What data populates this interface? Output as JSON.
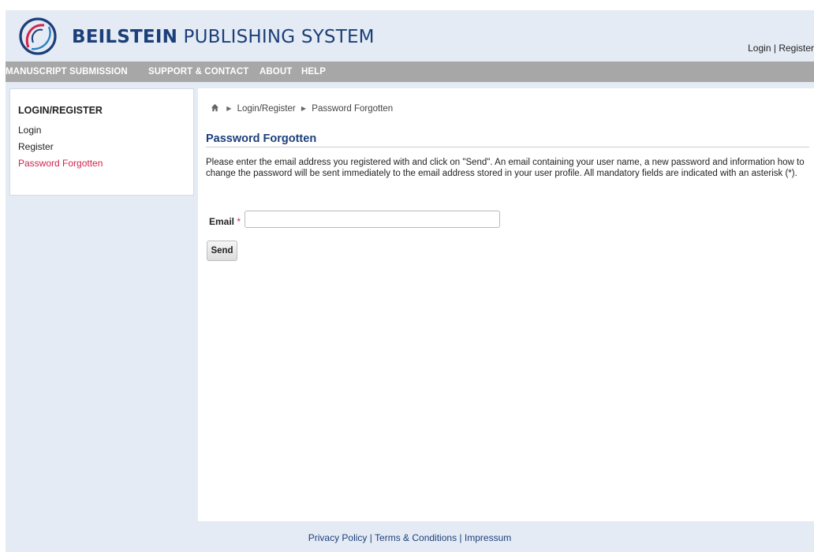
{
  "header": {
    "brand_bold": "BEILSTEIN",
    "brand_light": "PUBLISHING SYSTEM",
    "login_link": "Login",
    "separator": "|",
    "register_link": "Register"
  },
  "nav": {
    "items": [
      "MANUSCRIPT SUBMISSION",
      "SUPPORT & CONTACT",
      "ABOUT",
      "HELP"
    ]
  },
  "sidebar": {
    "title": "LOGIN/REGISTER",
    "items": [
      {
        "label": "Login"
      },
      {
        "label": "Register"
      },
      {
        "label": "Password Forgotten"
      }
    ]
  },
  "breadcrumb": {
    "items": [
      "Login/Register",
      "Password Forgotten"
    ]
  },
  "main": {
    "title": "Password Forgotten",
    "intro": "Please enter the email address you registered with and click on \"Send\". An email containing your user name, a new password and information how to change the password will be sent immediately to the email address stored in your user profile. All mandatory fields are indicated with an asterisk (*).",
    "email_label": "Email",
    "required_mark": "*",
    "email_value": "",
    "send_label": "Send"
  },
  "footer": {
    "links": [
      "Privacy Policy",
      "Terms & Conditions",
      "Impressum"
    ],
    "separator": "|"
  },
  "colors": {
    "page_bg": "#e4ebf4",
    "brand": "#1c3f7a",
    "nav_bg": "#a7a7a7",
    "active": "#d4224b"
  },
  "icons": {
    "logo": "beilstein-logo-icon",
    "home": "home-icon",
    "breadcrumb_sep": "triangle-right-icon"
  }
}
